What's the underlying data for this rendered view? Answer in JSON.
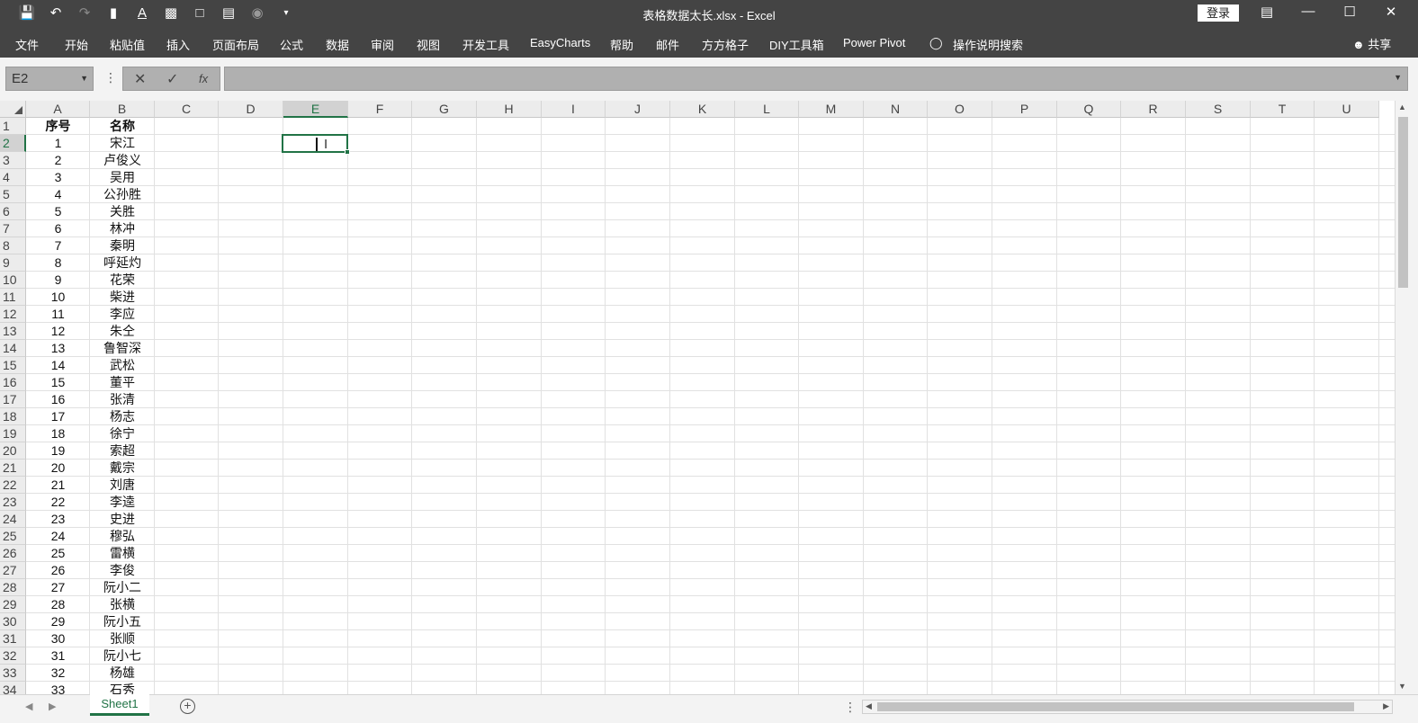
{
  "window": {
    "title": "表格数据太长.xlsx  -  Excel",
    "login": "登录",
    "qat_icons": [
      "save-icon",
      "undo-icon",
      "redo-icon",
      "format-painter-icon",
      "font-color-icon",
      "paste-icon",
      "doc-icon",
      "print-preview-icon",
      "camera-icon",
      "customize-icon"
    ]
  },
  "ribbon": {
    "tabs": [
      "文件",
      "开始",
      "粘贴值",
      "插入",
      "页面布局",
      "公式",
      "数据",
      "审阅",
      "视图",
      "开发工具",
      "EasyCharts",
      "帮助",
      "邮件",
      "方方格子",
      "DIY工具箱",
      "Power Pivot",
      "操作说明搜索"
    ],
    "share": "共享"
  },
  "formula_bar": {
    "name_box": "E2",
    "cancel": "✕",
    "enter": "✓",
    "fx": "fx",
    "content": ""
  },
  "grid": {
    "columns": [
      "A",
      "B",
      "C",
      "D",
      "E",
      "F",
      "G",
      "H",
      "I",
      "J",
      "K",
      "L",
      "M",
      "N",
      "O",
      "P",
      "Q",
      "R",
      "S",
      "T",
      "U"
    ],
    "selected_column": "E",
    "selected_row": 2,
    "header": [
      "序号",
      "名称"
    ],
    "rows": [
      [
        "1",
        "宋江"
      ],
      [
        "2",
        "卢俊义"
      ],
      [
        "3",
        "吴用"
      ],
      [
        "4",
        "公孙胜"
      ],
      [
        "5",
        "关胜"
      ],
      [
        "6",
        "林冲"
      ],
      [
        "7",
        "秦明"
      ],
      [
        "8",
        "呼延灼"
      ],
      [
        "9",
        "花荣"
      ],
      [
        "10",
        "柴进"
      ],
      [
        "11",
        "李应"
      ],
      [
        "12",
        "朱仝"
      ],
      [
        "13",
        "鲁智深"
      ],
      [
        "14",
        "武松"
      ],
      [
        "15",
        "董平"
      ],
      [
        "16",
        "张清"
      ],
      [
        "17",
        "杨志"
      ],
      [
        "18",
        "徐宁"
      ],
      [
        "19",
        "索超"
      ],
      [
        "20",
        "戴宗"
      ],
      [
        "21",
        "刘唐"
      ],
      [
        "22",
        "李逵"
      ],
      [
        "23",
        "史进"
      ],
      [
        "24",
        "穆弘"
      ],
      [
        "25",
        "雷横"
      ],
      [
        "26",
        "李俊"
      ],
      [
        "27",
        "阮小二"
      ],
      [
        "28",
        "张横"
      ],
      [
        "29",
        "阮小五"
      ],
      [
        "30",
        "张顺"
      ],
      [
        "31",
        "阮小七"
      ],
      [
        "32",
        "杨雄"
      ],
      [
        "33",
        "石秀"
      ]
    ]
  },
  "sheets": {
    "tabs": [
      "Sheet1"
    ],
    "add": "+"
  }
}
